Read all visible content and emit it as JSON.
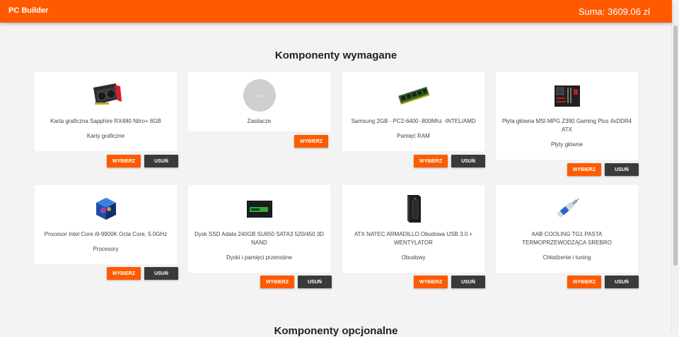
{
  "header": {
    "brand": "PC Builder",
    "total": "Suma: 3609.06 zł"
  },
  "required_section": {
    "title": "Komponenty wymagane"
  },
  "optional_section": {
    "title": "Komponenty opcjonalne"
  },
  "buttons": {
    "select": "WYBIERZ",
    "remove": "USUŃ"
  },
  "cards": [
    {
      "name": "Karta graficzna Sapphire RX480 Nitro+ 8GB",
      "category": "Karty graficzne",
      "icon": "graphics-card-icon"
    },
    {
      "name": "Zasilacze",
      "category": "",
      "icon": "placeholder-image-icon",
      "placeholder_text": "150x150"
    },
    {
      "name": "Samsung 2GB - PC2-6400 -800Mhz -INTEL/AMD",
      "category": "Pamięć RAM",
      "icon": "ram-stick-icon"
    },
    {
      "name": "Płyta główna MSI MPG Z390 Gaming Plus 4xDDR4 ATX",
      "category": "Płyty główne",
      "icon": "motherboard-icon"
    },
    {
      "name": "Procesor Intel Core i9-9900K Octa Core, 5.0GHz",
      "category": "Procesory",
      "icon": "cpu-box-icon"
    },
    {
      "name": "Dysk SSD Adata 240GB SU650 SATA3 520/450 3D NAND",
      "category": "Dyski i pamięci przenośne",
      "icon": "ssd-drive-icon"
    },
    {
      "name": "ATX NATEC ARMADILLO Obudowa USB 3.0 + WENTYLATOR",
      "category": "Obudowy",
      "icon": "pc-case-icon"
    },
    {
      "name": "AAB COOLING TG1 PASTA TERMOPRZEWODZĄCA SREBRO",
      "category": "Chłodzenie i tuning",
      "icon": "thermal-paste-icon"
    }
  ]
}
